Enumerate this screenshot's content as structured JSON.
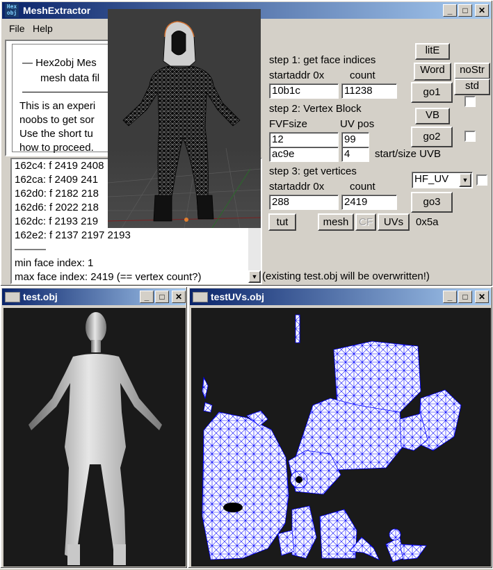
{
  "main": {
    "title": "MeshExtractor",
    "icon_text": "Hex obj",
    "menu": [
      "File",
      "Help"
    ],
    "header_text": [
      "—   Hex2obj Mes",
      "mesh data fil",
      "This is an experi",
      "noobs to get sor",
      "Use the short tu",
      "how to proceed."
    ],
    "log_lines": [
      "162c4: f  2419 2408",
      "162ca: f  2409 241",
      "162d0: f  2182 218",
      "162d6: f  2022 218",
      "162dc: f  2193 219",
      "162e2: f  2137 2197 2193",
      "———",
      "min face index: 1",
      "max face index: 2419 (== vertex count?)"
    ],
    "step1": {
      "title": "step 1: get face indices",
      "addr_label": "startaddr 0x",
      "count_label": "count",
      "addr": "10b1c",
      "count": "11238",
      "go": "go1"
    },
    "step2": {
      "title": "step 2: Vertex Block",
      "fvf_label": "FVFsize",
      "uv_label": "UV pos",
      "fvf": "12",
      "uvpos": "99",
      "start": "ac9e",
      "size": "4",
      "uvb_label": "start/size UVB",
      "vb": "VB",
      "go": "go2"
    },
    "step3": {
      "title": "step 3: get vertices",
      "addr_label": "startaddr 0x",
      "count_label": "count",
      "addr": "288",
      "count": "2419",
      "go": "go3",
      "select": "HF_UV"
    },
    "buttons": {
      "lite": "litE",
      "word": "Word",
      "nostr": "noStr",
      "std": "std",
      "tut": "tut",
      "mesh": "mesh",
      "cf": "CF",
      "uvs": "UVs",
      "hex": "0x5a"
    },
    "status": "(existing test.obj will be overwritten!)"
  },
  "obj_window": {
    "title": "test.obj"
  },
  "uv_window": {
    "title": "testUVs.obj"
  },
  "colors": {
    "title_start": "#0a246a",
    "title_end": "#a6caf0",
    "uv_wire": "#0000ff"
  }
}
